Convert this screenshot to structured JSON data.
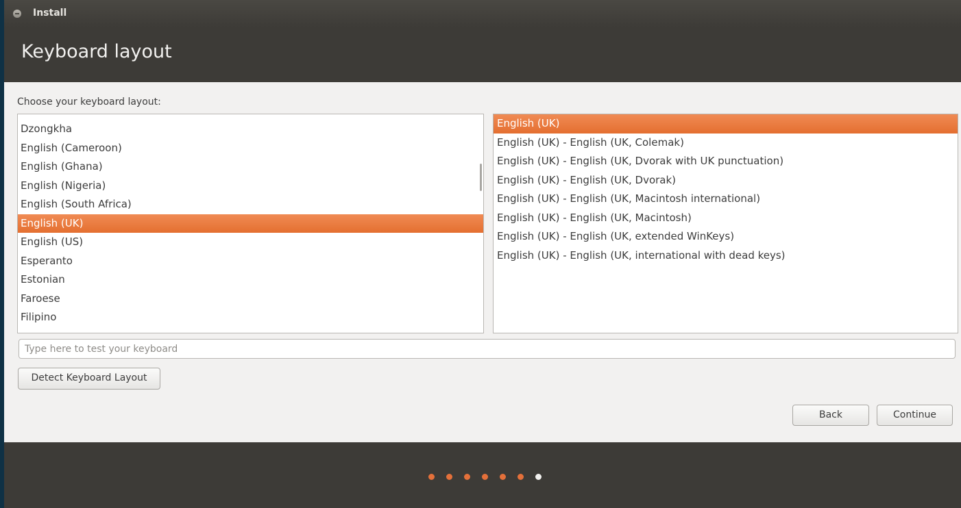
{
  "window": {
    "title": "Install"
  },
  "header": {
    "title": "Keyboard layout"
  },
  "main": {
    "prompt": "Choose your keyboard layout:",
    "layouts": [
      {
        "label": "Dzongkha",
        "selected": false
      },
      {
        "label": "English (Cameroon)",
        "selected": false
      },
      {
        "label": "English (Ghana)",
        "selected": false
      },
      {
        "label": "English (Nigeria)",
        "selected": false
      },
      {
        "label": "English (South Africa)",
        "selected": false
      },
      {
        "label": "English (UK)",
        "selected": true
      },
      {
        "label": "English (US)",
        "selected": false
      },
      {
        "label": "Esperanto",
        "selected": false
      },
      {
        "label": "Estonian",
        "selected": false
      },
      {
        "label": "Faroese",
        "selected": false
      },
      {
        "label": "Filipino",
        "selected": false
      }
    ],
    "variants": [
      {
        "label": "English (UK)",
        "selected": true
      },
      {
        "label": "English (UK) - English (UK, Colemak)",
        "selected": false
      },
      {
        "label": "English (UK) - English (UK, Dvorak with UK punctuation)",
        "selected": false
      },
      {
        "label": "English (UK) - English (UK, Dvorak)",
        "selected": false
      },
      {
        "label": "English (UK) - English (UK, Macintosh international)",
        "selected": false
      },
      {
        "label": "English (UK) - English (UK, Macintosh)",
        "selected": false
      },
      {
        "label": "English (UK) - English (UK, extended WinKeys)",
        "selected": false
      },
      {
        "label": "English (UK) - English (UK, international with dead keys)",
        "selected": false
      }
    ],
    "test_input": {
      "placeholder": "Type here to test your keyboard",
      "value": ""
    },
    "detect_button": "Detect Keyboard Layout",
    "back_button": "Back",
    "continue_button": "Continue"
  },
  "progress": {
    "total_steps": 7,
    "completed_steps": 6
  },
  "colors": {
    "accent": "#e46f30",
    "window_bg": "#3d3b37",
    "content_bg": "#f2f1f0"
  }
}
